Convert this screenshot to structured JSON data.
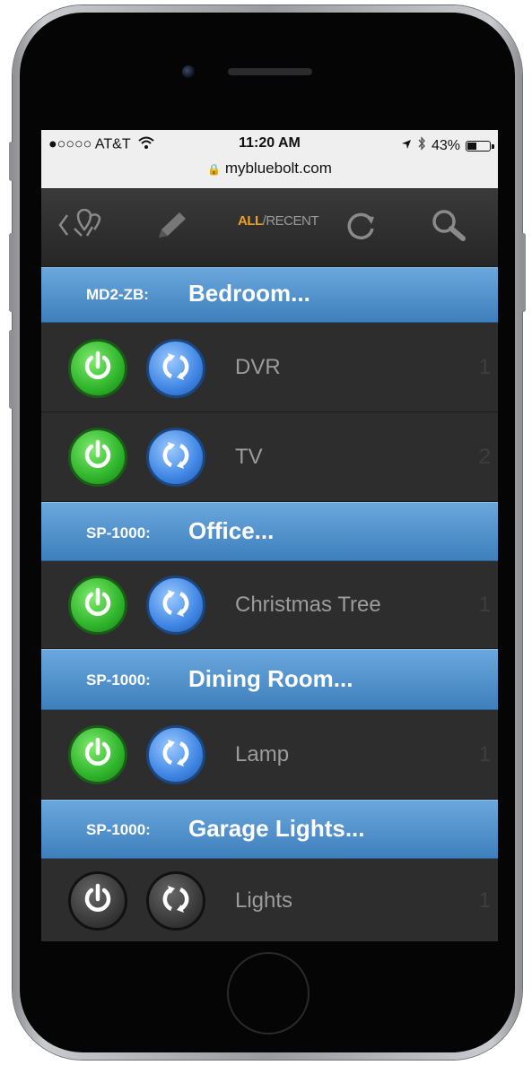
{
  "status_bar": {
    "carrier": "●○○○○ AT&T",
    "time": "11:20 AM",
    "battery": "43%",
    "url": "mybluebolt.com",
    "battery_level": 0.43
  },
  "toolbar": {
    "filter_all": "ALL",
    "filter_sep": "/",
    "filter_recent": "RECENT",
    "icons": [
      "back-location-icon",
      "pencil-icon",
      "refresh-icon",
      "search-icon"
    ]
  },
  "colors": {
    "header_blue": "#4a8ccb",
    "filter_active": "#f0a020",
    "power_on": "#2fb52b",
    "sync_on": "#3f86e4"
  },
  "groups": [
    {
      "model": "MD2-ZB:",
      "name": "Bedroom...",
      "devices": [
        {
          "label": "DVR",
          "number": "1",
          "active": true
        },
        {
          "label": "TV",
          "number": "2",
          "active": true
        }
      ]
    },
    {
      "model": "SP-1000:",
      "name": "Office...",
      "devices": [
        {
          "label": "Christmas Tree",
          "number": "1",
          "active": true
        }
      ]
    },
    {
      "model": "SP-1000:",
      "name": "Dining Room...",
      "devices": [
        {
          "label": "Lamp",
          "number": "1",
          "active": true
        }
      ]
    },
    {
      "model": "SP-1000:",
      "name": "Garage Lights...",
      "devices": [
        {
          "label": "Lights",
          "number": "1",
          "active": false
        }
      ]
    }
  ]
}
